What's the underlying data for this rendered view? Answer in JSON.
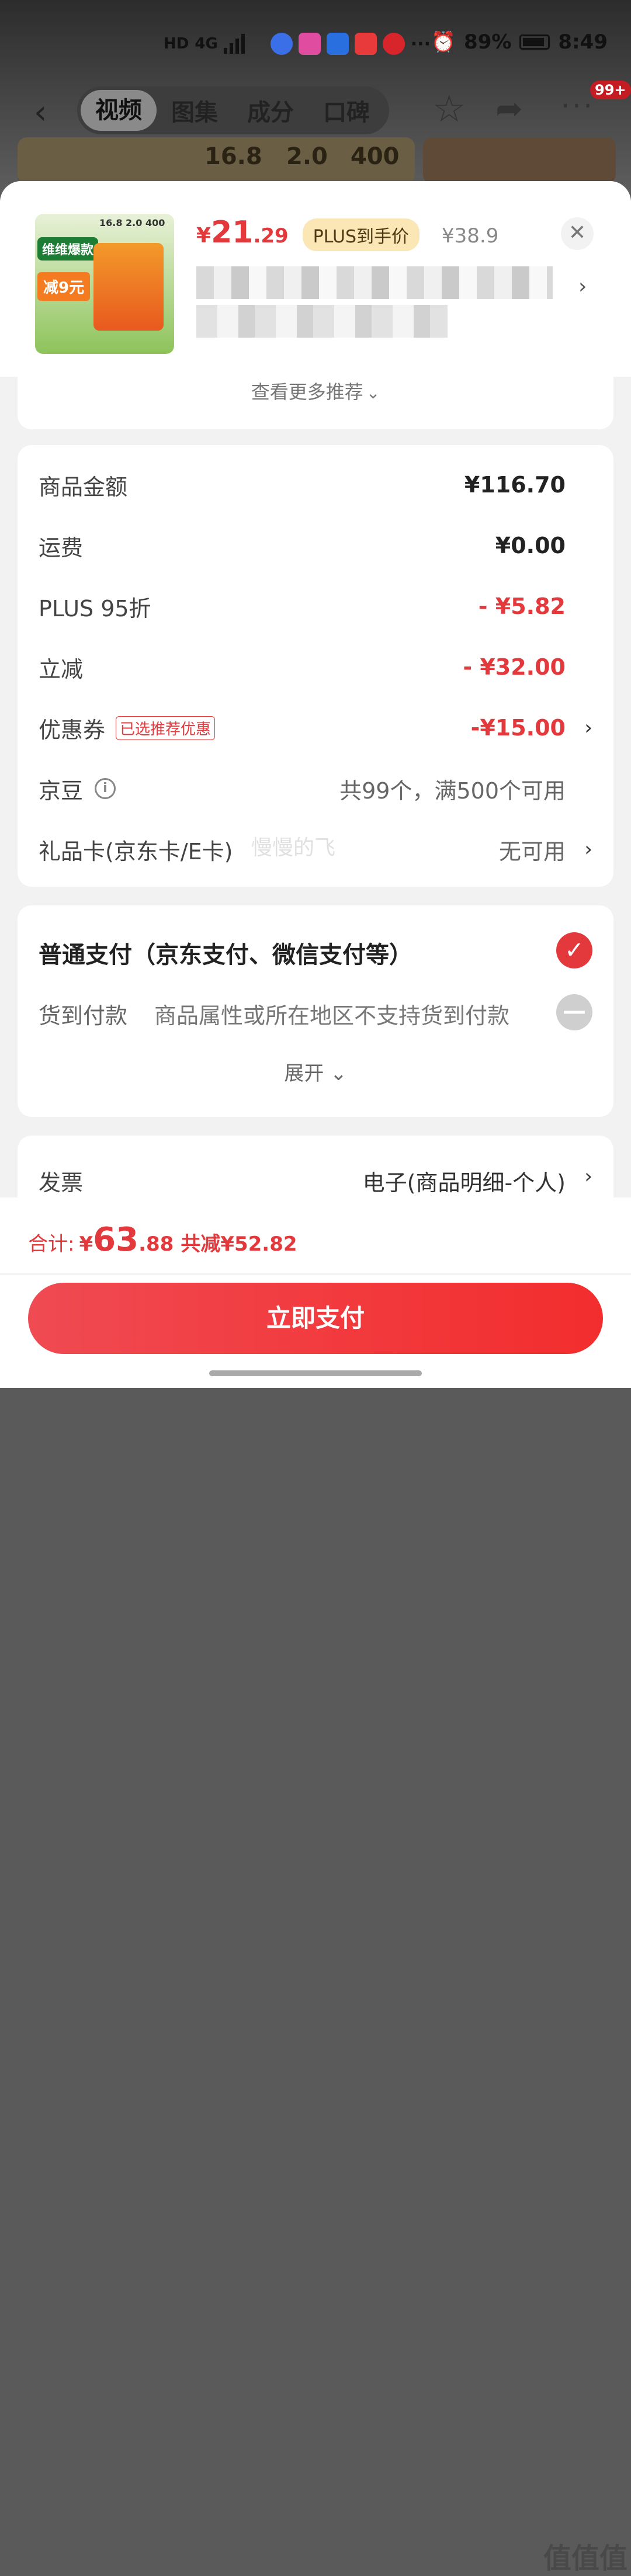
{
  "status_bar": {
    "net": "HD",
    "sim": "4G",
    "battery": "89%",
    "time": "8:49"
  },
  "nav": {
    "tabs": [
      "视频",
      "图集",
      "成分",
      "口碑"
    ],
    "badge": "99+"
  },
  "hero": {
    "values": [
      "16.8",
      "2.0",
      "400"
    ]
  },
  "product": {
    "thumb_tag1": "维维爆款",
    "thumb_tag2": "减9元",
    "thumb_nums": "16.8 2.0 400",
    "price_currency": "¥",
    "price_int": "21",
    "price_dec": ".29",
    "plus_tag": "PLUS到手价",
    "orig_price": "¥38.9"
  },
  "more_recommend": "查看更多推荐",
  "summary": {
    "rows": [
      {
        "label": "商品金额",
        "value": "¥116.70"
      },
      {
        "label": "运费",
        "value": "¥0.00"
      },
      {
        "label": "PLUS 95折",
        "value": "- ¥5.82"
      },
      {
        "label": "立减",
        "value": "- ¥32.00"
      },
      {
        "label": "优惠券",
        "tag": "已选推荐优惠",
        "value": "-¥15.00"
      },
      {
        "label": "京豆",
        "value": "共99个，满500个可用"
      },
      {
        "label": "礼品卡(京东卡/E卡)",
        "value": "无可用"
      }
    ]
  },
  "payment": {
    "normal": "普通支付（京东支付、微信支付等）",
    "cod_label": "货到付款",
    "cod_desc": "商品属性或所在地区不支持货到付款",
    "expand": "展开"
  },
  "invoice": {
    "label": "发票",
    "value": "电子(商品明细-个人)"
  },
  "bottom": {
    "total_label": "合计:",
    "currency": "¥",
    "total_int": "63",
    "total_dec": ".88",
    "saved": "共减¥52.82",
    "pay_button": "立即支付"
  },
  "watermark": "慢慢的飞",
  "corner_logo": "值值值"
}
